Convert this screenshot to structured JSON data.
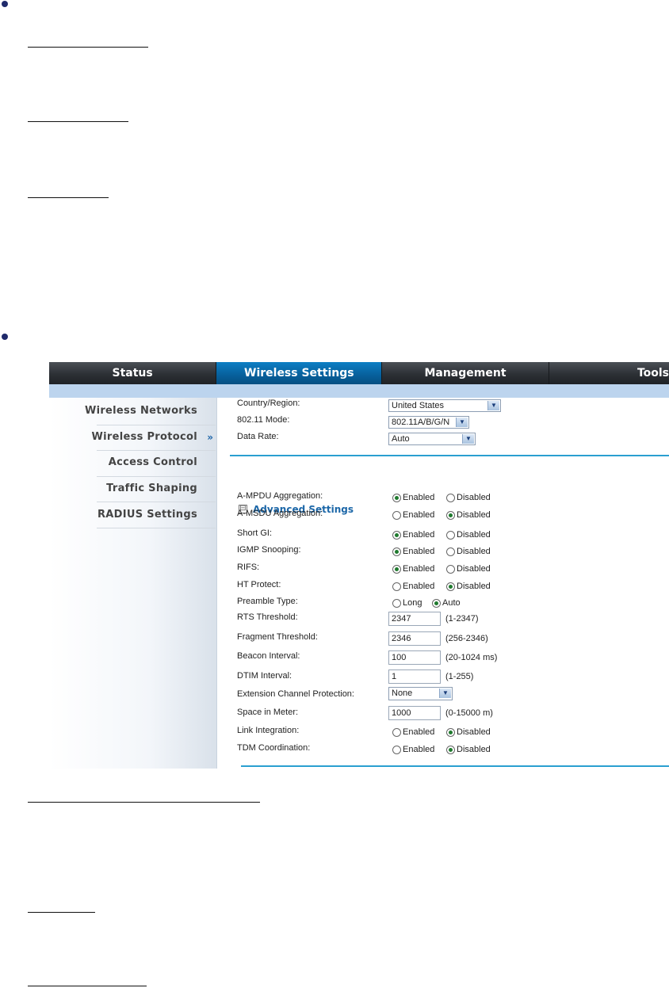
{
  "nav": [
    "Status",
    "Wireless Settings",
    "Management",
    "Tools"
  ],
  "sidebar": [
    "Wireless Networks",
    "Wireless Protocol",
    "Access Control",
    "Traffic Shaping",
    "RADIUS Settings"
  ],
  "sidebar_arrow": "»",
  "basic": {
    "country_label": "Country/Region:",
    "country_value": "United States",
    "mode_label": "802.11 Mode:",
    "mode_value": "802.11A/B/G/N",
    "rate_label": "Data Rate:",
    "rate_value": "Auto"
  },
  "advanced": {
    "toggle": "⊟",
    "title": "Advanced Settings",
    "radios": [
      {
        "label": "A-MPDU Aggregation:",
        "opt1": "Enabled",
        "opt2": "Disabled",
        "selected": 1
      },
      {
        "label": "A-MSDU Aggregation:",
        "opt1": "Enabled",
        "opt2": "Disabled",
        "selected": 2
      },
      {
        "label": "Short GI:",
        "opt1": "Enabled",
        "opt2": "Disabled",
        "selected": 1
      },
      {
        "label": "IGMP Snooping:",
        "opt1": "Enabled",
        "opt2": "Disabled",
        "selected": 1
      },
      {
        "label": "RIFS:",
        "opt1": "Enabled",
        "opt2": "Disabled",
        "selected": 1
      },
      {
        "label": "HT Protect:",
        "opt1": "Enabled",
        "opt2": "Disabled",
        "selected": 2
      },
      {
        "label": "Preamble Type:",
        "opt1": "Long",
        "opt2": "Auto",
        "selected": 2
      }
    ],
    "rts_label": "RTS Threshold:",
    "rts_value": "2347",
    "rts_hint": "(1-2347)",
    "frag_label": "Fragment Threshold:",
    "frag_value": "2346",
    "frag_hint": "(256-2346)",
    "beacon_label": "Beacon Interval:",
    "beacon_value": "100",
    "beacon_hint": "(20-1024 ms)",
    "dtim_label": "DTIM Interval:",
    "dtim_value": "1",
    "dtim_hint": "(1-255)",
    "ext_label": "Extension Channel Protection:",
    "ext_value": "None",
    "space_label": "Space in Meter:",
    "space_value": "1000",
    "space_hint": "(0-15000 m)",
    "link": {
      "label": "Link Integration:",
      "opt1": "Enabled",
      "opt2": "Disabled",
      "selected": 2
    },
    "tdm": {
      "label": "TDM Coordination:",
      "opt1": "Enabled",
      "opt2": "Disabled",
      "selected": 2
    }
  },
  "colors": {
    "accent": "#0d7fc4",
    "nav_bg": "#2c3035",
    "subbar": "#bcd4ee",
    "divider": "#2a9fd0"
  }
}
